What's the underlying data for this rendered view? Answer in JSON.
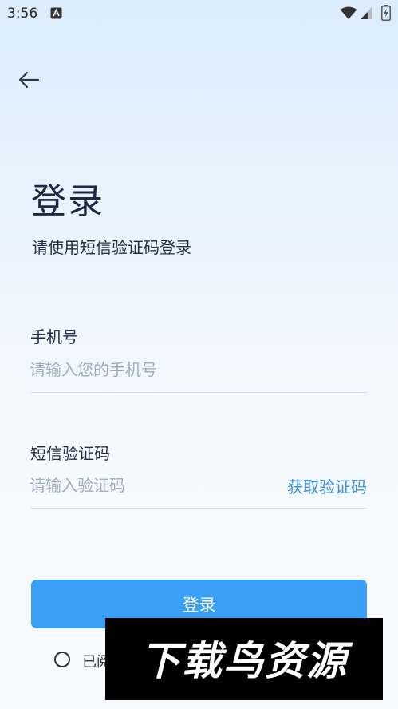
{
  "status_bar": {
    "time": "3:56",
    "icons": [
      "a-icon",
      "wifi-icon",
      "signal-icon",
      "battery-icon"
    ]
  },
  "header": {
    "back_icon": "arrow-left-icon"
  },
  "title": "登录",
  "subtitle": "请使用短信验证码登录",
  "phone_field": {
    "label": "手机号",
    "placeholder": "请输入您的手机号",
    "value": ""
  },
  "code_field": {
    "label": "短信验证码",
    "placeholder": "请输入验证码",
    "value": "",
    "get_code_label": "获取验证码"
  },
  "login_button_label": "登录",
  "agreement": {
    "text": "已阅",
    "checked": false
  },
  "watermark": {
    "text": "下载鸟资源"
  },
  "colors": {
    "accent": "#3aa0f6",
    "link": "#3a8fd6",
    "placeholder": "#9eacc0",
    "title": "#1c2744"
  }
}
